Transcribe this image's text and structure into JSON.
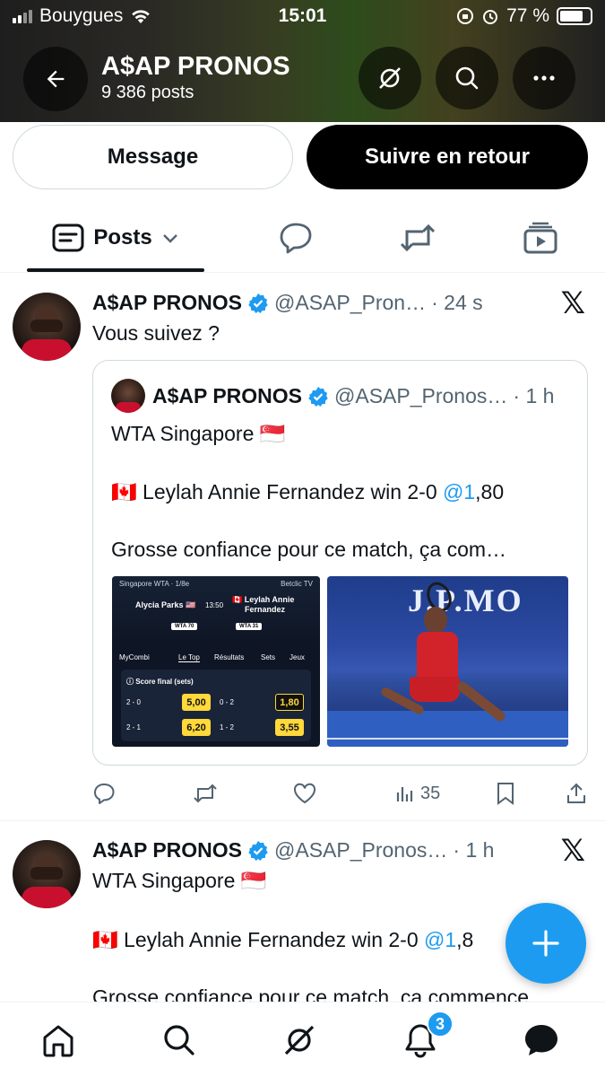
{
  "status_bar": {
    "carrier": "Bouygues",
    "time": "15:01",
    "battery": "77 %",
    "battery_level": 0.77
  },
  "header": {
    "title": "A$AP PRONOS",
    "post_count": "9 386 posts"
  },
  "profile_actions": {
    "message_label": "Message",
    "follow_back_label": "Suivre en retour"
  },
  "tabs": {
    "posts_label": "Posts"
  },
  "tweet1": {
    "name": "A$AP PRONOS",
    "handle": "@ASAP_Pron…",
    "time": "· 24 s",
    "text": "Vous suivez ?",
    "quote": {
      "name": "A$AP PRONOS",
      "handle": "@ASAP_Pronos…",
      "time": "· 1 h",
      "line1": "WTA Singapore 🇸🇬",
      "line2_prefix": "🇨🇦 Leylah Annie Fernandez win 2-0 ",
      "line2_mention": "@1",
      "line2_suffix": ",80",
      "line3": "Grosse confiance pour ce match, ça com…"
    },
    "views": "35"
  },
  "bet_image": {
    "event": "Singapore WTA · 1/8e",
    "broadcaster": "Betclic TV",
    "player1": "Alycia Parks 🇺🇸",
    "time": "13:50",
    "player2_line1": "🇨🇦 Leylah Annie",
    "player2_line2": "Fernandez",
    "rank1": "WTA 70",
    "rank2": "WTA 31",
    "nav": [
      "MyCombi",
      "Le Top",
      "Résultats",
      "Sets",
      "Jeux"
    ],
    "market": "ⓘ Score final (sets)",
    "scores": [
      "2 - 0",
      "0 - 2",
      "2 - 1",
      "1 - 2"
    ],
    "odds": [
      "5,00",
      "1,80",
      "6,20",
      "3,55"
    ]
  },
  "photo_image": {
    "banner": "J.P.MO"
  },
  "tweet2": {
    "name": "A$AP PRONOS",
    "handle": "@ASAP_Pronos…",
    "time": "· 1 h",
    "line1": "WTA Singapore 🇸🇬",
    "line2_prefix": "🇨🇦 Leylah Annie Fernandez win 2-0 ",
    "line2_mention": "@1",
    "line2_suffix": ",8",
    "line3": "Grosse confiance pour ce match, ça commence"
  },
  "bottom_nav": {
    "notifications_badge": "3"
  },
  "colors": {
    "accent": "#1d9bf0",
    "text": "#0f1419",
    "secondary": "#536471"
  }
}
